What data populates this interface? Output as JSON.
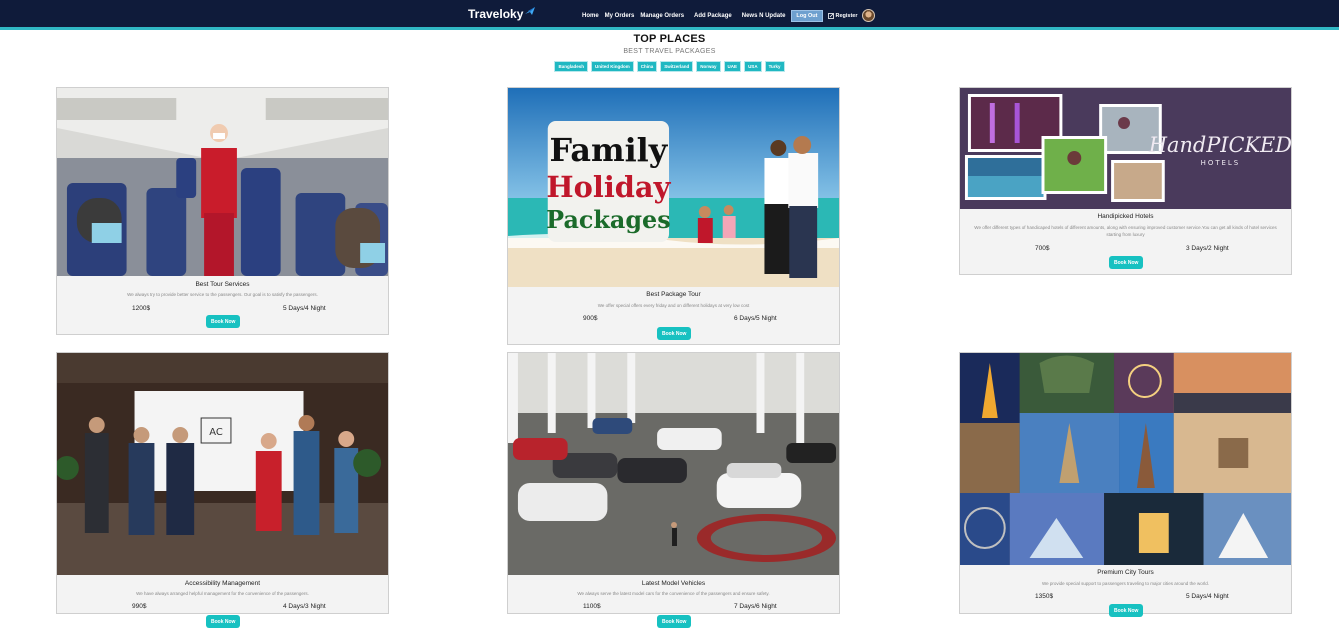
{
  "brand": {
    "name": "Traveloky"
  },
  "nav": {
    "home": "Home",
    "my_orders": "My Orders",
    "manage_orders": "Manage Orders",
    "add_package": "Add Package",
    "news": "News N Update",
    "logout": "Log Out",
    "register": "Register"
  },
  "heading": {
    "title": "TOP PLACES",
    "subtitle": "BEST TRAVEL PACKAGES"
  },
  "tags": [
    "Bangladesh",
    "United Kingdom",
    "China",
    "Switzerland",
    "Norway",
    "UAE",
    "USA",
    "Turky"
  ],
  "cards": [
    {
      "title": "Best Tour Services",
      "desc": "We always try to provide better service to the passengers. Our goal is to satisfy the passengers.",
      "price": "1200$",
      "duration": "5 Days/4 Night",
      "button": "Book Now"
    },
    {
      "title": "Best Package Tour",
      "desc": "We offer special offers every friday and on different holidays at very low cost",
      "price": "900$",
      "duration": "6 Days/5 Night",
      "button": "Book Now",
      "image_text": [
        "Family",
        "Holiday",
        "Packages"
      ]
    },
    {
      "title": "Handipicked Hotels",
      "desc": "We offer different types of handicaped hotels of different amounts, along with ensuring improved customer service.You can get all kinds of hotel services starting from luxury",
      "price": "700$",
      "duration": "3 Days/2 Night",
      "button": "Book Now",
      "image_text": [
        "HandPICKED",
        "HOTELS"
      ]
    },
    {
      "title": "Accessibility Management",
      "desc": "We have always arranged helpful management for the convenience of the passengers.",
      "price": "990$",
      "duration": "4 Days/3 Night",
      "button": "Book Now",
      "image_text": [
        "AC"
      ]
    },
    {
      "title": "Latest Model Vehicles",
      "desc": "We always serve the latest model cars for the convenience of the passengers and ensure safety.",
      "price": "1100$",
      "duration": "7 Days/6 Night",
      "button": "Book Now"
    },
    {
      "title": "Premium City Tours",
      "desc": "We provide special support to passengers traveling to major cities around the world.",
      "price": "1350$",
      "duration": "5 Days/4 Night",
      "button": "Book Now"
    }
  ],
  "colors": {
    "navbar": "#0f1b3a",
    "accent": "#20b8c2",
    "button": "#17c1c1"
  }
}
